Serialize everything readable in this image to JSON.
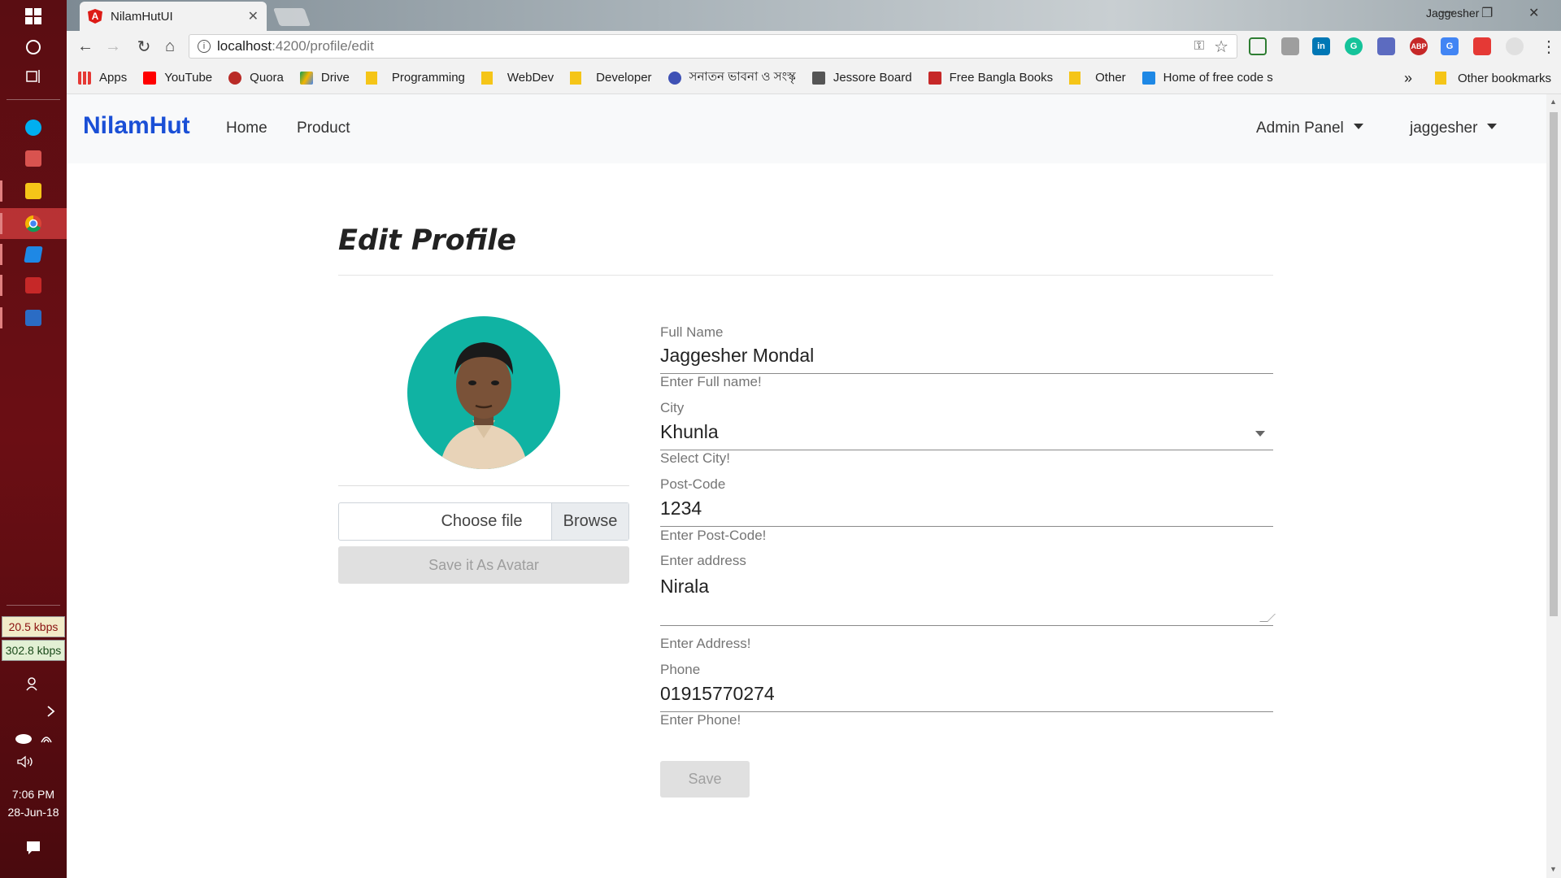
{
  "taskbar": {
    "speed_up": "20.5 kbps",
    "speed_down": "302.8 kbps",
    "time": "7:06 PM",
    "date": "28-Jun-18"
  },
  "browser": {
    "tab_title": "NilamHutUI",
    "profile_name": "Jaggesher",
    "url_host": "localhost",
    "url_path": ":4200/profile/edit",
    "bookmarks": [
      "Apps",
      "YouTube",
      "Quora",
      "Drive",
      "Programming",
      "WebDev",
      "Developer",
      "সনাতন ভাবনা ও সংস্কৃ",
      "Jessore Board",
      "Free Bangla Books",
      "Other",
      "Home of free code s"
    ],
    "bookmarks_more": "»",
    "other_bookmarks": "Other bookmarks"
  },
  "navbar": {
    "brand": "NilamHut",
    "links": [
      "Home",
      "Product"
    ],
    "admin_panel": "Admin Panel",
    "user": "jaggesher"
  },
  "page": {
    "title": "Edit Profile",
    "file_choose": "Choose file",
    "file_browse": "Browse",
    "save_avatar": "Save it As Avatar",
    "save": "Save"
  },
  "form": {
    "full_name": {
      "label": "Full Name",
      "value": "Jaggesher Mondal",
      "hint": "Enter Full name!"
    },
    "city": {
      "label": "City",
      "value": "Khunla",
      "hint": "Select City!"
    },
    "post_code": {
      "label": "Post-Code",
      "value": "1234",
      "hint": "Enter Post-Code!"
    },
    "address": {
      "label": "Enter address",
      "value": "Nirala",
      "hint": "Enter Address!"
    },
    "phone": {
      "label": "Phone",
      "value": "01915770274",
      "hint": "Enter Phone!"
    }
  },
  "colors": {
    "brand": "#1a4fd6",
    "avatar_bg": "#10b3a3",
    "taskbar": "#5a0d12"
  }
}
